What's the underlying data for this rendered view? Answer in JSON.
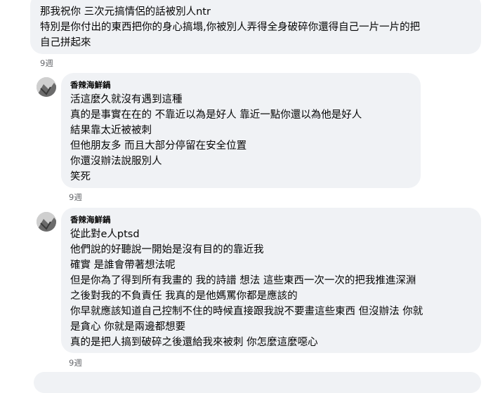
{
  "comments": [
    {
      "lines": [
        "那我祝你 三次元搞情侶的話被別人ntr",
        "特別是你付出的東西把你的身心搞塌,你被別人弄得全身破碎你還得自己一片一片的把",
        "自己拼起來"
      ],
      "time": "9週"
    },
    {
      "author": "香辣海鮮鍋",
      "lines": [
        "活這麼久就沒有遇到這種",
        "真的是事實在在的 不靠近以為是好人 靠近一點你還以為他是好人",
        "結果靠太近被被刺",
        "但他朋友多 而且大部分停留在安全位置",
        "你還沒辦法說服別人",
        "笑死"
      ],
      "time": "9週"
    },
    {
      "author": "香辣海鮮鍋",
      "lines": [
        "從此對e人ptsd",
        "他們說的好聽說一開始是沒有目的的靠近我",
        "確實 是誰會帶著想法呢",
        "但是你為了得到所有我畫的 我的詩譜 想法 這些東西一次一次的把我推進深淵",
        "之後對我的不負責任 我真的是他媽罵你都是應該的",
        "你早就應該知道自己控制不住的時候直接跟我說不要畫這些東西 但沒辦法 你就",
        "是貪心 你就是兩邊都想要",
        "真的是把人搞到破碎之後還給我來被刺 你怎麼這麼噁心"
      ],
      "time": "9週"
    }
  ]
}
